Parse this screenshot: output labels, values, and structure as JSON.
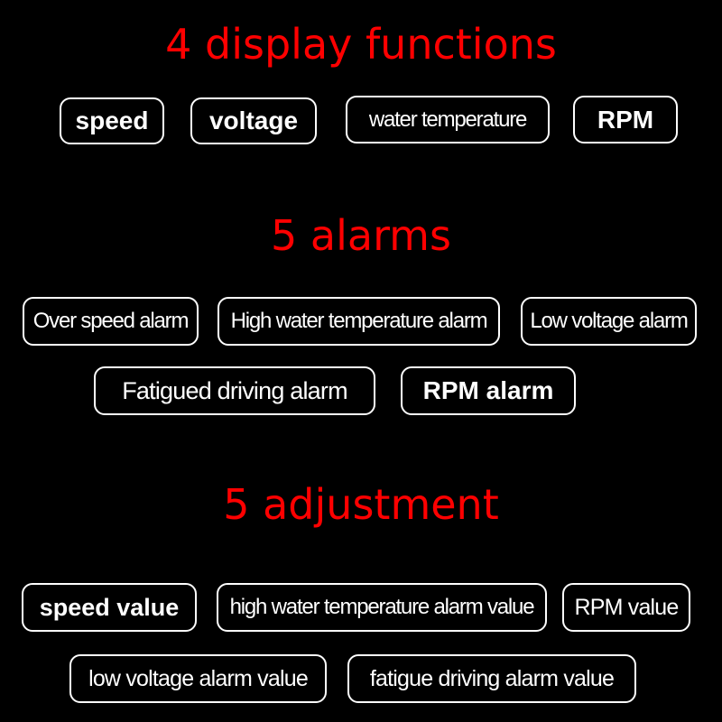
{
  "sections": [
    {
      "title": "4 display functions",
      "items": [
        "speed",
        "voltage",
        "water temperature",
        "RPM"
      ]
    },
    {
      "title": "5 alarms",
      "items": [
        "Over speed alarm",
        "High water temperature alarm",
        "Low voltage alarm",
        "Fatigued driving alarm",
        "RPM alarm"
      ]
    },
    {
      "title": "5 adjustment",
      "items": [
        "speed value",
        "high water temperature alarm value",
        "RPM value",
        "low voltage alarm value",
        "fatigue driving alarm value"
      ]
    }
  ],
  "colors": {
    "heading": "#ff0000",
    "pill_border": "#ffffff",
    "text": "#ffffff",
    "background": "#000000"
  }
}
